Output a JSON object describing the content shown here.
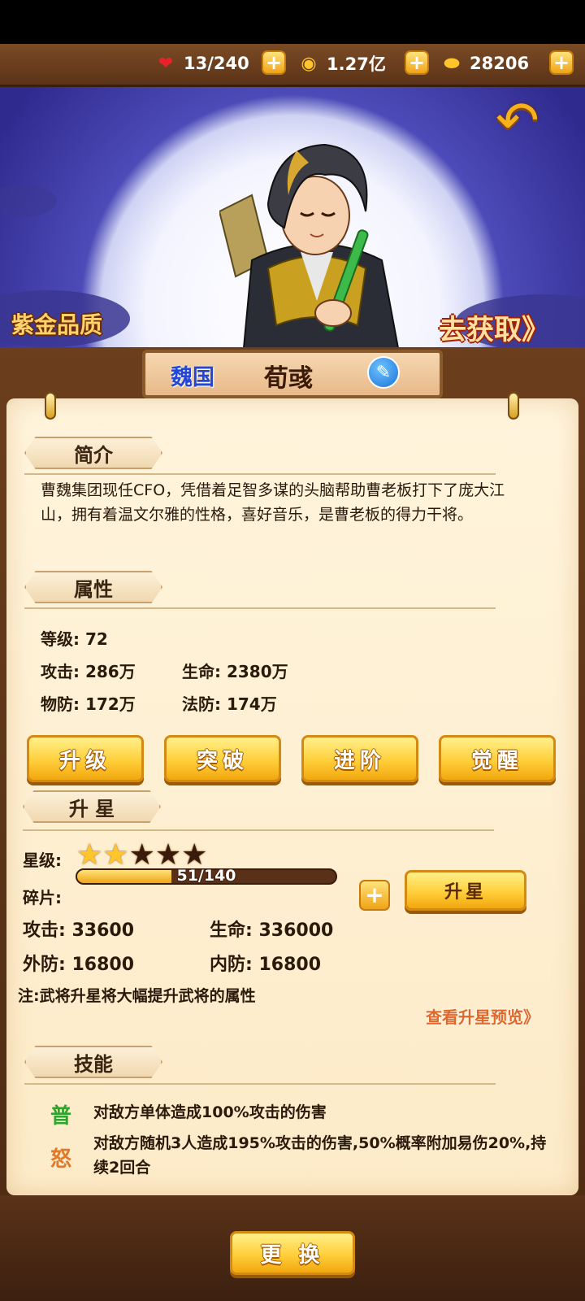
{
  "resources": {
    "stamina": "13/240",
    "coins": "1.27亿",
    "ingots": "28206"
  },
  "colors": {
    "accent_gold": "#ffcf3a",
    "faction_blue": "#2346d8",
    "wood": "#5c3418",
    "parchment": "#fff4dc"
  },
  "hero": {
    "quality": "紫金品质",
    "obtain": "去获取》",
    "faction": "魏国",
    "name": "荀彧"
  },
  "intro": {
    "title": "简介",
    "text": "曹魏集团现任CFO，凭借着足智多谋的头脑帮助曹老板打下了庞大江山，拥有着温文尔雅的性格，喜好音乐，是曹老板的得力干将。"
  },
  "attributes": {
    "title": "属性",
    "level": "等级:  72",
    "attack": "攻击:  286万",
    "hp": "生命:  2380万",
    "pdef": "物防:  172万",
    "mdef": "法防:  174万"
  },
  "actions": {
    "upgrade": "升级",
    "breakthrough": "突破",
    "advance": "进阶",
    "awaken": "觉醒"
  },
  "stars": {
    "title": "升 星",
    "rating_label": "星级:",
    "rating": 2,
    "rating_max": 5,
    "shards_label": "碎片:",
    "shards": "51/140",
    "shards_current": 51,
    "shards_max": 140,
    "star_up": "升星",
    "attack": "攻击:  33600",
    "hp": "生命:  336000",
    "outer_def": "外防:  16800",
    "inner_def": "内防:  16800",
    "note": "注:武将升星将大幅提升武将的属性",
    "preview": "查看升星预览》"
  },
  "skills": {
    "title": "技能",
    "items": [
      {
        "tag": "普",
        "tag_color": "#2ea62e",
        "text": "对敌方单体造成100%攻击的伤害"
      },
      {
        "tag": "怒",
        "tag_color": "#e07a2a",
        "text": "对敌方随机3人造成195%攻击的伤害,50%概率附加易伤20%,持续2回合"
      }
    ]
  },
  "replace": "更 换"
}
